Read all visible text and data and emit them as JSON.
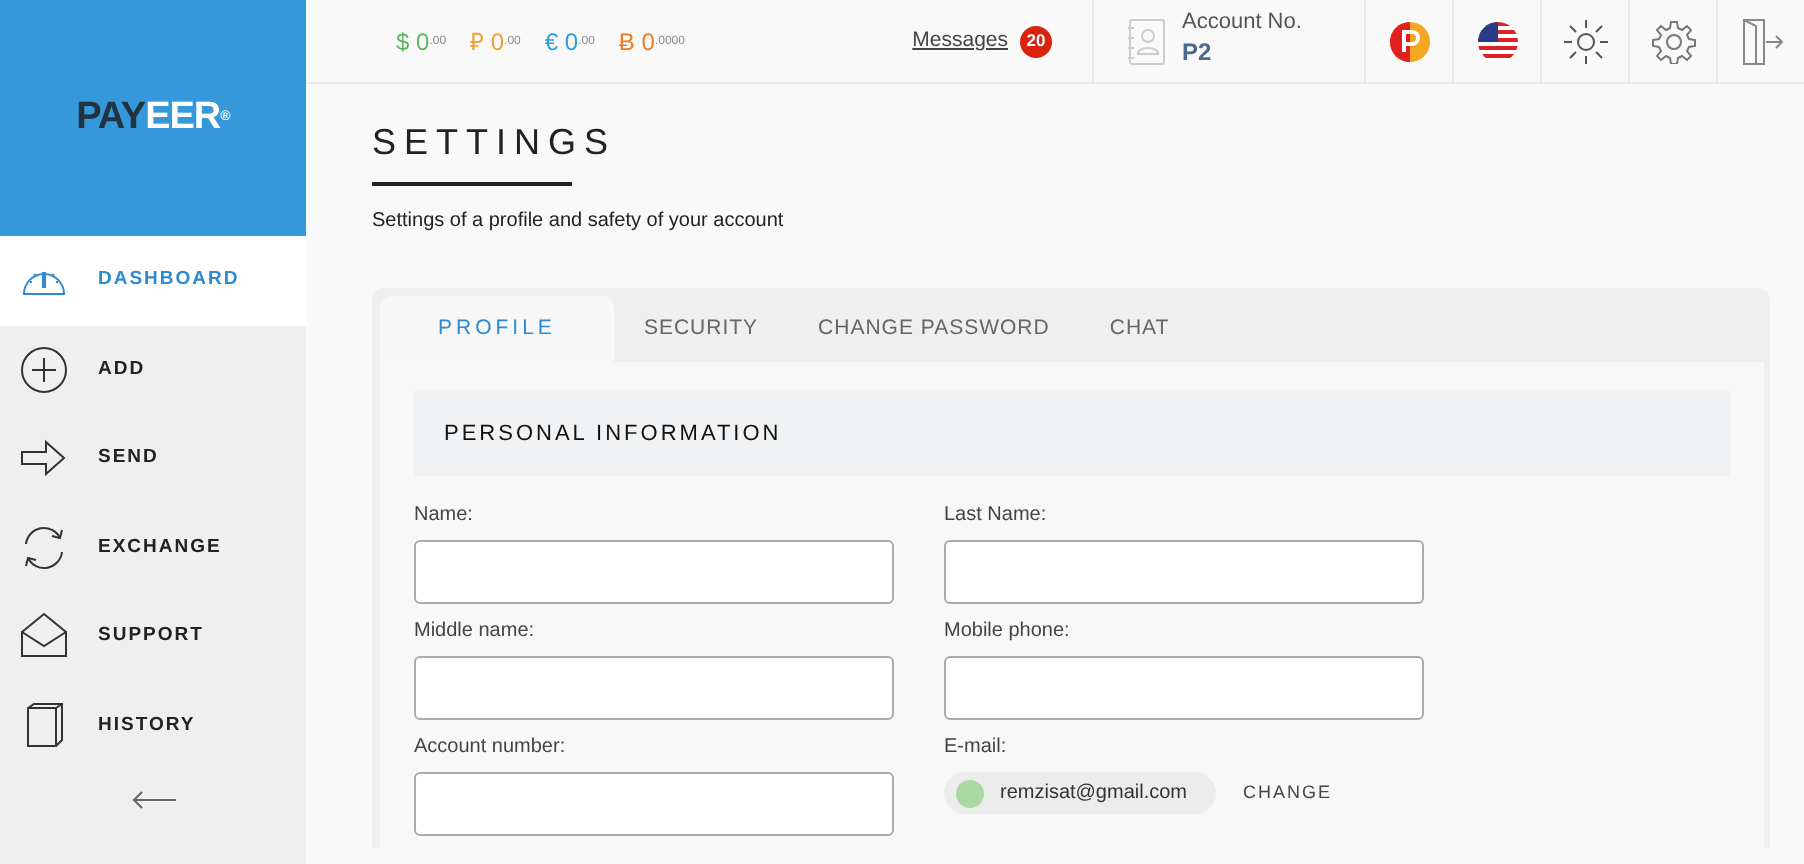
{
  "logo": {
    "part_1": "PAY",
    "part_2": "EER",
    "mark": "®"
  },
  "balances": [
    {
      "symbol": "$",
      "amount": "0",
      "decimals": ".00",
      "color": "#5cb85c"
    },
    {
      "symbol": "₽",
      "amount": "0",
      "decimals": ".00",
      "color": "#f0a030"
    },
    {
      "symbol": "€",
      "amount": "0",
      "decimals": ".00",
      "color": "#2d9be0"
    },
    {
      "symbol": "Ƀ",
      "amount": "0",
      "decimals": ".0000",
      "color": "#f07a20"
    }
  ],
  "messages": {
    "label": "Messages",
    "count": "20"
  },
  "account": {
    "label": "Account No.",
    "number": "P2"
  },
  "sidebar": {
    "items": [
      {
        "label": "DASHBOARD",
        "selected": true
      },
      {
        "label": "ADD",
        "selected": false
      },
      {
        "label": "SEND",
        "selected": false
      },
      {
        "label": "EXCHANGE",
        "selected": false
      },
      {
        "label": "SUPPORT",
        "selected": false
      },
      {
        "label": "HISTORY",
        "selected": false
      }
    ]
  },
  "page": {
    "title": "SETTINGS",
    "subtitle": "Settings of a profile and safety of your account"
  },
  "tabs": [
    {
      "label": "PROFILE",
      "selected": true
    },
    {
      "label": "SECURITY",
      "selected": false
    },
    {
      "label": "CHANGE PASSWORD",
      "selected": false
    },
    {
      "label": "CHAT",
      "selected": false
    }
  ],
  "section": {
    "title": "PERSONAL INFORMATION"
  },
  "fields": [
    {
      "label": "Name:"
    },
    {
      "label": "Last Name:"
    },
    {
      "label": "Middle name:"
    },
    {
      "label": "Mobile phone:"
    },
    {
      "label": "Account number:"
    }
  ],
  "email": {
    "label": "E-mail:",
    "value": "remzisat@gmail.com",
    "action": "CHANGE"
  }
}
